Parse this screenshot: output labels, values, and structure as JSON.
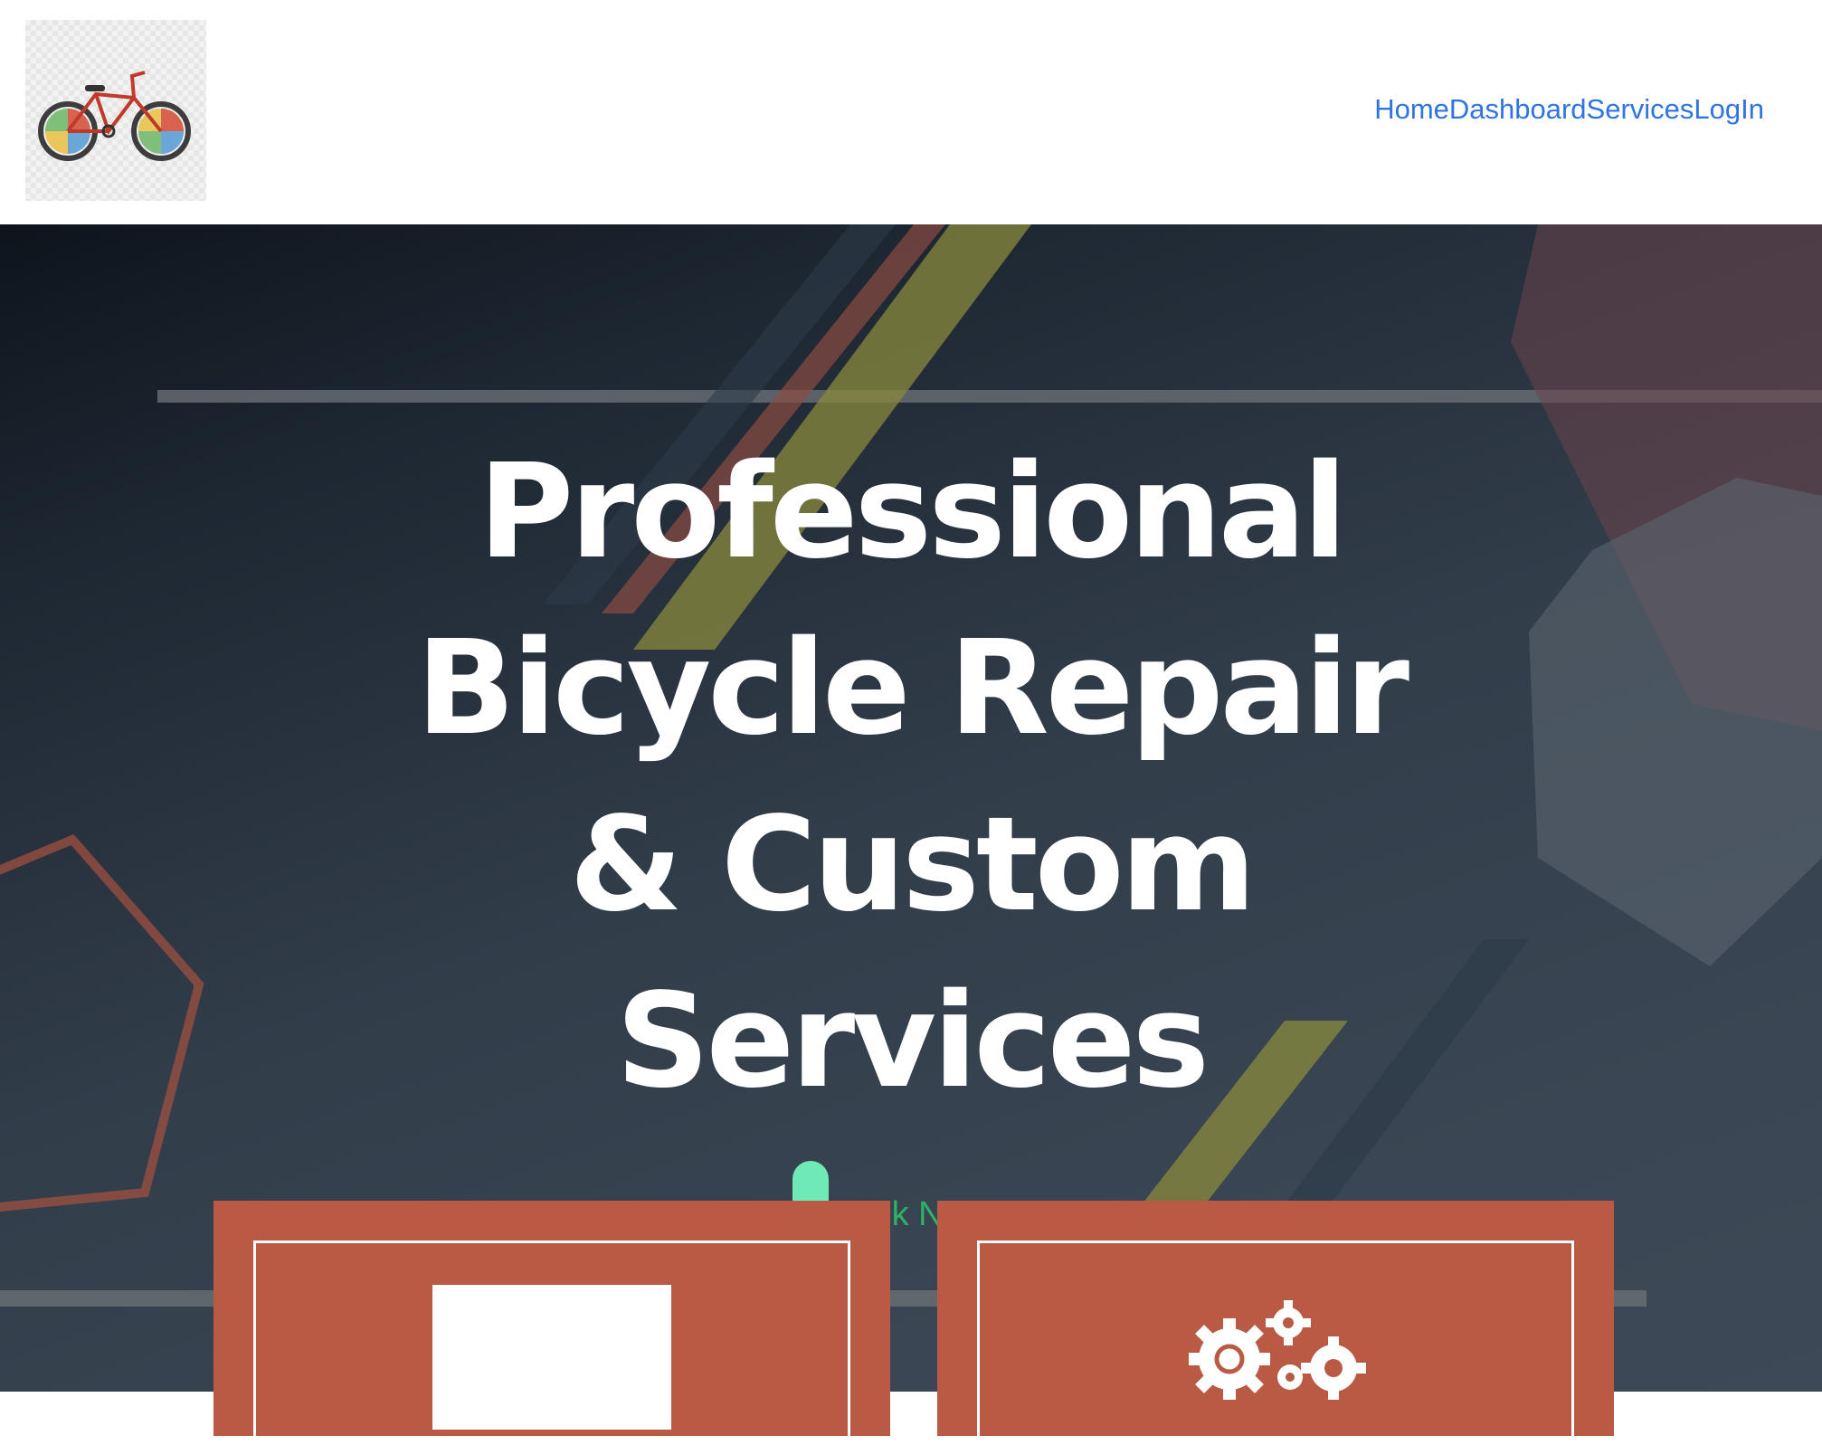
{
  "header": {
    "logo": {
      "icon": "bicycle-logo"
    },
    "nav": [
      {
        "label": "Home"
      },
      {
        "label": "Dashboard"
      },
      {
        "label": "Services"
      },
      {
        "label": "LogIn"
      }
    ]
  },
  "hero": {
    "title": "Professional\nBicycle Repair\n& Custom\nServices",
    "cta_label": "Book Now"
  },
  "cards": [
    {
      "icon": "image-placeholder"
    },
    {
      "icon": "gears-icon"
    }
  ],
  "colors": {
    "nav_link": "#2f74e0",
    "card_bg": "#b95b44",
    "cta_text": "#2eb266",
    "cta_pill": "#6fe9b6"
  }
}
